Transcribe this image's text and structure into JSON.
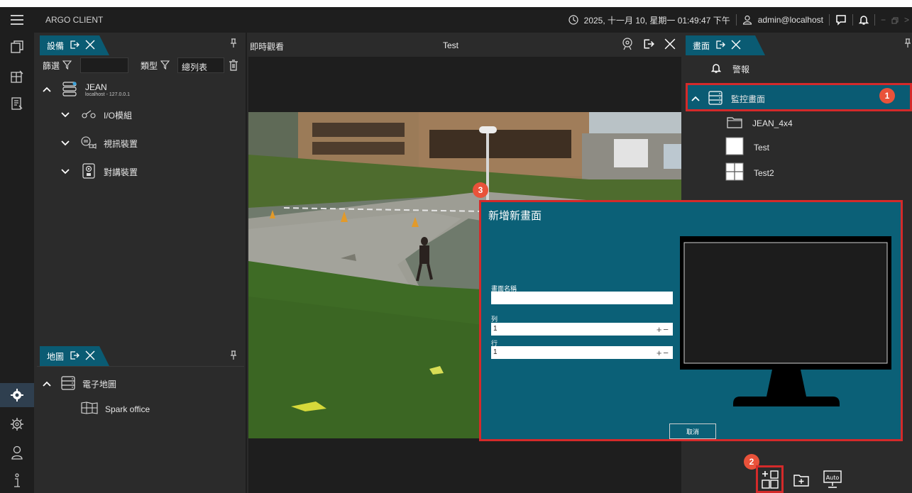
{
  "app": {
    "title": "ARGO CLIENT"
  },
  "header": {
    "datetime": "2025, 十一月 10, 星期一 01:49:47 下午",
    "user": "admin@localhost"
  },
  "devices_panel": {
    "tab_label": "設備",
    "filter_label": "篩選",
    "filter_value": "",
    "type_label": "類型",
    "type_value": "總列表",
    "server": {
      "name": "JEAN",
      "address": "localhost - 127.0.0.1"
    },
    "groups": [
      {
        "label": "I/O模組",
        "icon": "io-module-icon"
      },
      {
        "label": "視訊裝置",
        "icon": "video-device-icon"
      },
      {
        "label": "對講裝置",
        "icon": "intercom-icon"
      }
    ]
  },
  "map_panel": {
    "tab_label": "地圖",
    "root_label": "電子地圖",
    "item_label": "Spark office"
  },
  "live_view": {
    "label": "即時觀看",
    "screen_name": "Test"
  },
  "screens_panel": {
    "tab_label": "畫面",
    "alarm_label": "警報",
    "monitor_label": "監控畫面",
    "items": [
      {
        "label": "JEAN_4x4",
        "icon": "folder-icon"
      },
      {
        "label": "Test",
        "icon": "single-layout-icon"
      },
      {
        "label": "Test2",
        "icon": "quad-layout-icon"
      }
    ]
  },
  "dialog": {
    "title": "新增新畫面",
    "name_label": "畫面名稱",
    "name_value": "",
    "columns_label": "列",
    "columns_value": "1",
    "rows_label": "行",
    "rows_value": "1",
    "cancel_label": "取消"
  },
  "annotations": {
    "one": "1",
    "two": "2",
    "three": "3"
  },
  "auto_label": "Auto",
  "colors": {
    "accent": "#0a5b73",
    "dialog_bg": "#0b6077",
    "highlight": "#d42a2a",
    "badge": "#e9523a"
  }
}
